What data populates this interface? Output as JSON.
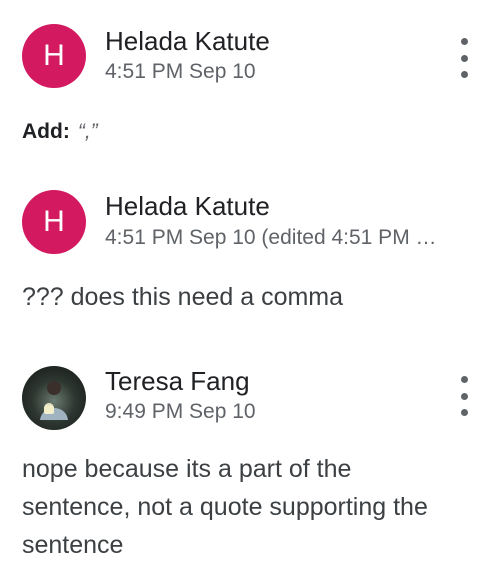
{
  "comments": [
    {
      "avatar_letter": "H",
      "avatar_color": "#d3195f",
      "author": "Helada Katute",
      "time": "4:51 PM Sep 10",
      "suggestion_label": "Add:",
      "suggestion_text": "“,”",
      "menu_icon": "more-vert-icon"
    },
    {
      "avatar_letter": "H",
      "avatar_color": "#d3195f",
      "author": "Helada Katute",
      "time": "4:51 PM Sep 10 (edited 4:51 PM …",
      "text": "??? does this need a comma"
    },
    {
      "avatar_icon": "user-photo-avatar",
      "author": "Teresa Fang",
      "time": "9:49 PM Sep 10",
      "text_lines": [
        "nope because its a part of the",
        "sentence, not a quote supporting the",
        "sentence"
      ],
      "menu_icon": "more-vert-icon"
    }
  ]
}
